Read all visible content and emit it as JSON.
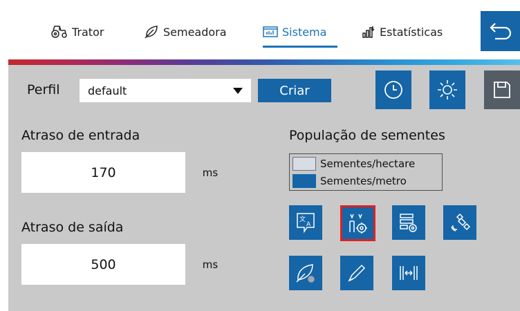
{
  "tabs": [
    {
      "label": "Trator",
      "icon": "tractor-icon",
      "active": false
    },
    {
      "label": "Semeadora",
      "icon": "seeder-icon",
      "active": false
    },
    {
      "label": "Sistema",
      "icon": "system-icon",
      "active": true
    },
    {
      "label": "Estatísticas",
      "icon": "statistics-icon",
      "active": false
    }
  ],
  "profile": {
    "label": "Perfil",
    "selected": "default",
    "create_label": "Criar"
  },
  "entry_delay": {
    "label": "Atraso de entrada",
    "value": "170",
    "unit": "ms"
  },
  "exit_delay": {
    "label": "Atraso de saída",
    "value": "500",
    "unit": "ms"
  },
  "population": {
    "title": "População de sementes",
    "options": [
      {
        "label": "Sementes/hectare",
        "selected": false
      },
      {
        "label": "Sementes/metro",
        "selected": true
      }
    ]
  },
  "colors": {
    "accent": "#1565a7",
    "panel": "#c9c9c9",
    "selected_outline": "#e02020",
    "save_button": "#545d66"
  }
}
